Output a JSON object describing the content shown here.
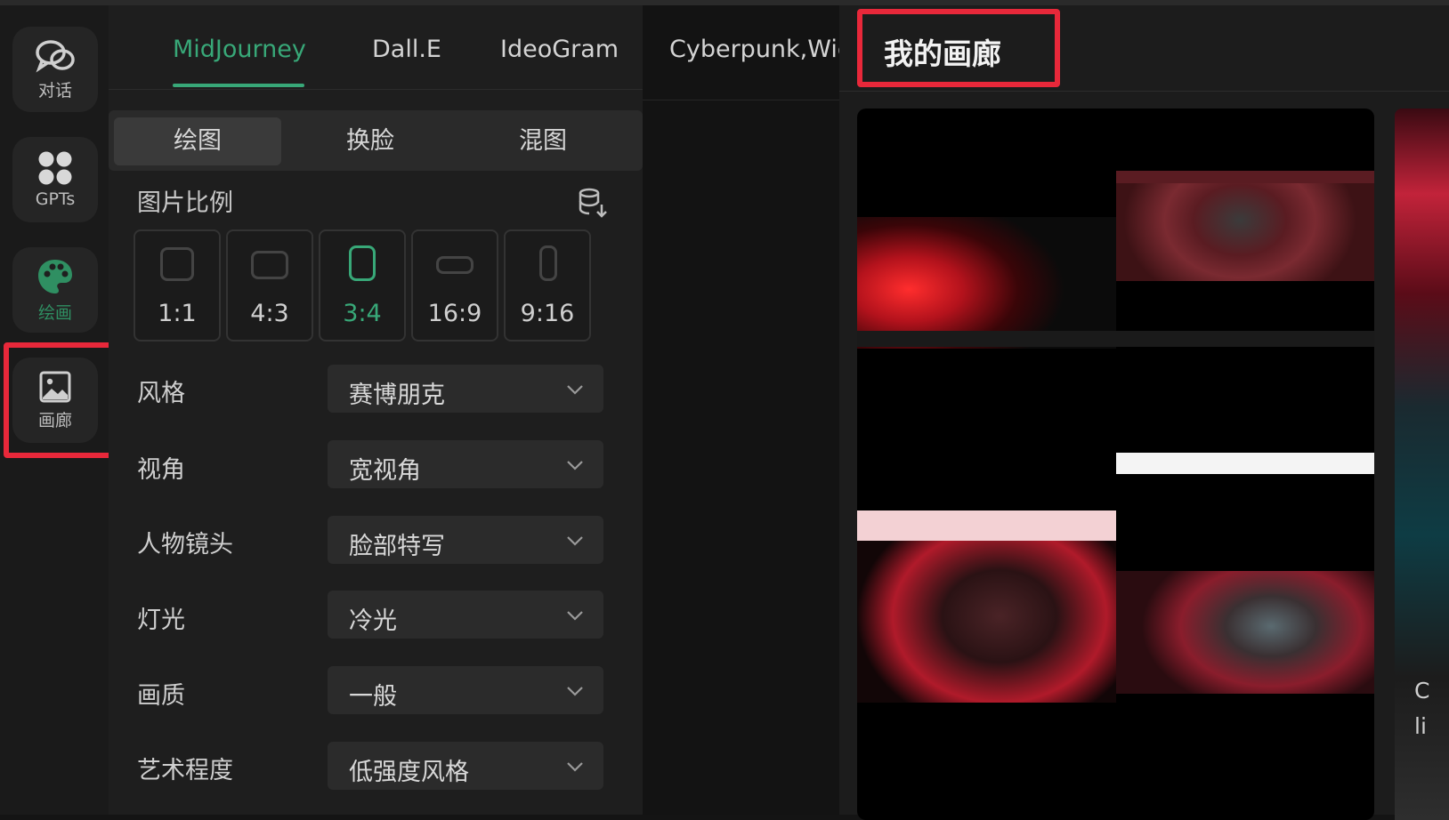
{
  "rail": {
    "items": [
      {
        "label": "对话",
        "icon": "chat-bubbles-icon"
      },
      {
        "label": "GPTs",
        "icon": "grid-apps-icon"
      },
      {
        "label": "绘画",
        "icon": "palette-icon"
      },
      {
        "label": "画廊",
        "icon": "image-icon"
      }
    ],
    "active": "绘画"
  },
  "model_tabs": [
    "MidJourney",
    "Dall.E",
    "IdeoGram"
  ],
  "active_model_tab": "MidJourney",
  "mode_tabs": [
    "绘图",
    "换脸",
    "混图"
  ],
  "active_mode_tab": "绘图",
  "aspect": {
    "title": "图片比例",
    "options": [
      "1:1",
      "4:3",
      "3:4",
      "16:9",
      "9:16"
    ],
    "selected": "3:4"
  },
  "fields": [
    {
      "label": "风格",
      "value": "赛博朋克"
    },
    {
      "label": "视角",
      "value": "宽视角"
    },
    {
      "label": "人物镜头",
      "value": "脸部特写"
    },
    {
      "label": "灯光",
      "value": "冷光"
    },
    {
      "label": "画质",
      "value": "一般"
    },
    {
      "label": "艺术程度",
      "value": "低强度风格"
    }
  ],
  "middle": {
    "tab": "Cyberpunk,Wic"
  },
  "gallery": {
    "title": "我的画廊",
    "side_text_1": "C",
    "side_text_2": "li"
  },
  "colors": {
    "accent": "#38a878",
    "highlight": "#e8283a",
    "background": "#141414"
  }
}
